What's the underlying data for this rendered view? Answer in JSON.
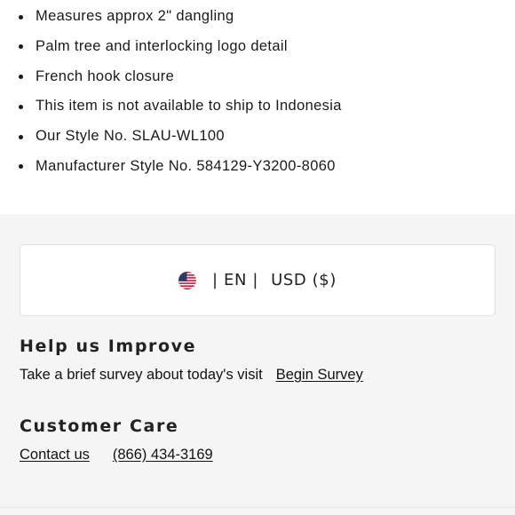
{
  "product_details": {
    "items": [
      "Measures approx 2\" dangling",
      "Palm tree and interlocking logo detail",
      "French hook closure",
      "This item is not available to ship to Indonesia",
      "Our Style No. SLAU-WL100",
      "Manufacturer Style No. 584129-Y3200-8060"
    ]
  },
  "locale": {
    "flag_icon": "us-flag-icon",
    "language": "| EN |",
    "currency": "USD ($)"
  },
  "help": {
    "title": "Help us Improve",
    "survey_text": "Take a brief survey about today's visit",
    "survey_link": "Begin Survey"
  },
  "customer_care": {
    "title": "Customer Care",
    "contact_link": "Contact us",
    "phone": "(866) 434-3169"
  },
  "colors": {
    "footer_background": "#f5f5f5",
    "text": "#1a1a1a"
  }
}
